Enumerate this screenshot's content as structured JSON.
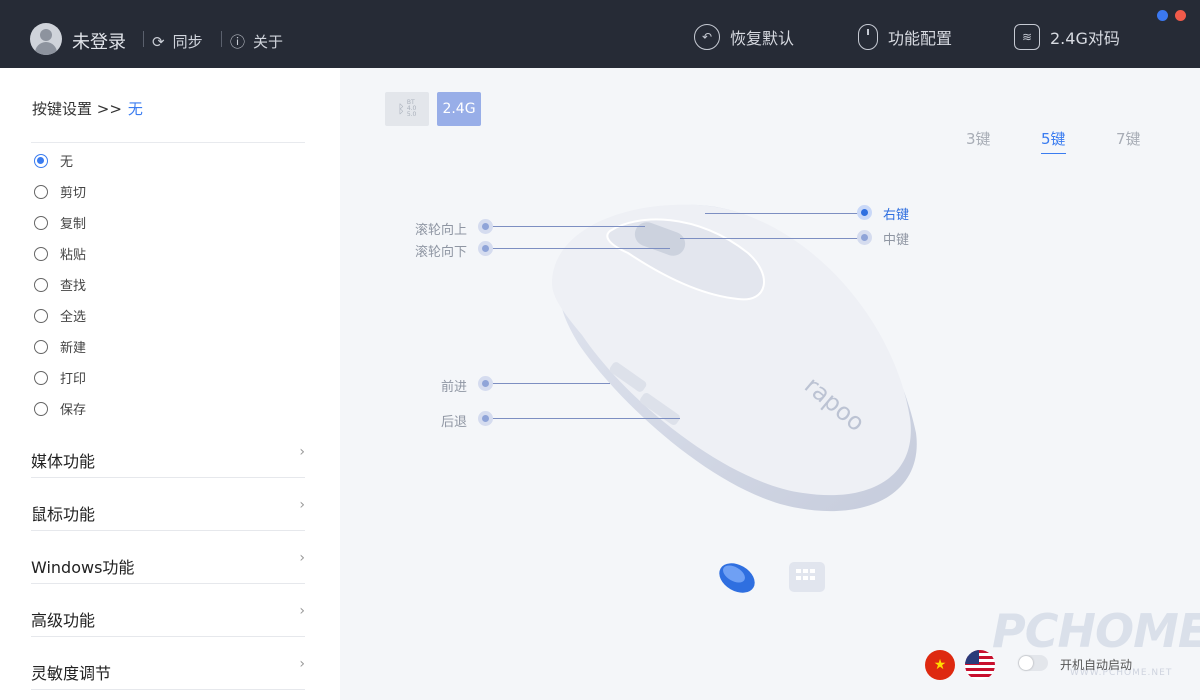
{
  "topbar": {
    "login": "未登录",
    "sync": "同步",
    "about": "关于",
    "restore_default": "恢复默认",
    "function_config": "功能配置",
    "pairing": "2.4G对码",
    "window_dots": [
      "#3b78f0",
      "#f05a4a"
    ]
  },
  "sidebar": {
    "key_setting_label": "按键设置 >>",
    "key_setting_value": "无",
    "options": [
      "无",
      "剪切",
      "复制",
      "粘贴",
      "查找",
      "全选",
      "新建",
      "打印",
      "保存"
    ],
    "selected_option": "无",
    "categories": [
      "媒体功能",
      "鼠标功能",
      "Windows功能",
      "高级功能",
      "灵敏度调节"
    ]
  },
  "main": {
    "mode_bt": "BT",
    "mode_bt_versions": [
      "4.0",
      "5.0"
    ],
    "mode_24g": "2.4G",
    "key_tabs": [
      "3键",
      "5键",
      "7键"
    ],
    "active_key_tab": "5键",
    "mouse_brand": "rapoo",
    "labels": {
      "scroll_up": "滚轮向上",
      "scroll_down": "滚轮向下",
      "forward": "前进",
      "back": "后退",
      "right_key": "右键",
      "middle_key": "中键"
    },
    "active_button": "右键",
    "autostart_label": "开机自动启动",
    "autostart_on": false,
    "watermark": "PCHOME",
    "watermark_url": "WWW.PCHOME.NET"
  }
}
